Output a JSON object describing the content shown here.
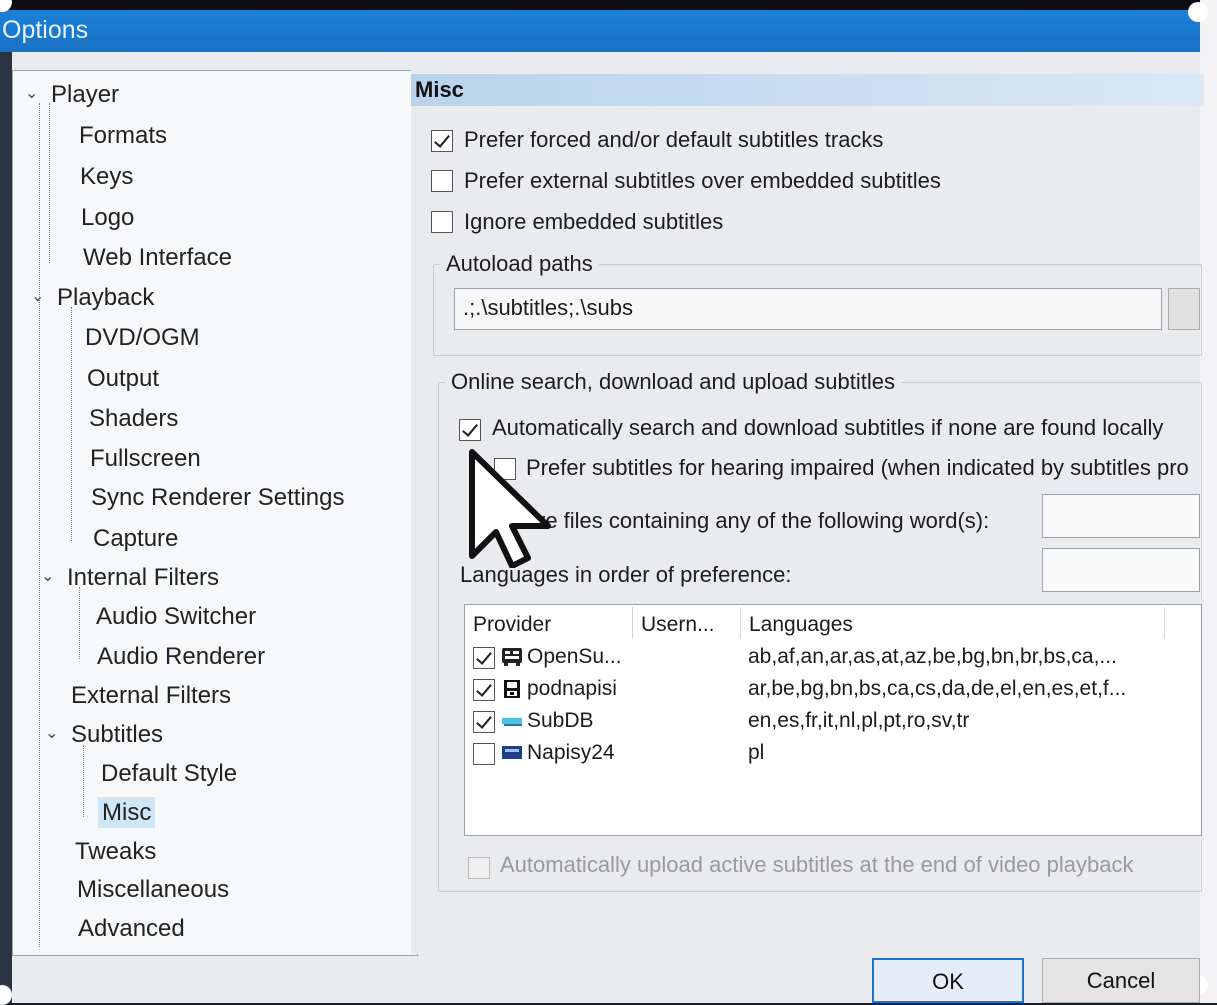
{
  "window": {
    "title": "Options"
  },
  "tree": {
    "items": [
      {
        "label": "Player",
        "expander": "⌄"
      },
      {
        "label": "Formats"
      },
      {
        "label": "Keys"
      },
      {
        "label": "Logo"
      },
      {
        "label": "Web Interface"
      },
      {
        "label": "Playback",
        "expander": "⌄"
      },
      {
        "label": "DVD/OGM"
      },
      {
        "label": "Output"
      },
      {
        "label": "Shaders"
      },
      {
        "label": "Fullscreen"
      },
      {
        "label": "Sync Renderer Settings"
      },
      {
        "label": "Capture"
      },
      {
        "label": "Internal Filters",
        "expander": "⌄"
      },
      {
        "label": "Audio Switcher"
      },
      {
        "label": "Audio Renderer"
      },
      {
        "label": "External Filters"
      },
      {
        "label": "Subtitles",
        "expander": "⌄"
      },
      {
        "label": "Default Style"
      },
      {
        "label": "Misc",
        "selected": true
      },
      {
        "label": "Tweaks"
      },
      {
        "label": "Miscellaneous"
      },
      {
        "label": "Advanced"
      }
    ]
  },
  "panel": {
    "header": "Misc",
    "options": {
      "prefer_forced": {
        "label": "Prefer forced and/or default subtitles tracks",
        "checked": true
      },
      "prefer_external": {
        "label": "Prefer external subtitles over embedded subtitles",
        "checked": false
      },
      "ignore_embedded": {
        "label": "Ignore embedded subtitles",
        "checked": false
      }
    },
    "autoload": {
      "title": "Autoload paths",
      "value": ".;.\\subtitles;.\\subs"
    },
    "online": {
      "title": "Online search, download and upload subtitles",
      "auto_search": {
        "label": "Automatically search and download subtitles if none are found locally",
        "checked": true
      },
      "hearing_impaired": {
        "label": "Prefer subtitles for hearing impaired (when indicated by subtitles pro",
        "checked": false
      },
      "exclude_label": "re files containing any of the following word(s):",
      "languages_label": "Languages in order of preference:",
      "upload": {
        "label": "Automatically upload active subtitles at the end of video playback",
        "checked": false
      }
    },
    "providers": {
      "columns": [
        "Provider",
        "Usern...",
        "Languages"
      ],
      "rows": [
        {
          "checked": true,
          "icon": "opensubtitles-icon",
          "name": "OpenSu...",
          "languages": "ab,af,an,ar,as,at,az,be,bg,bn,br,bs,ca,..."
        },
        {
          "checked": true,
          "icon": "podnapisi-icon",
          "name": "podnapisi",
          "languages": "ar,be,bg,bn,bs,ca,cs,da,de,el,en,es,et,f..."
        },
        {
          "checked": true,
          "icon": "subdb-icon",
          "name": "SubDB",
          "languages": "en,es,fr,it,nl,pl,pt,ro,sv,tr"
        },
        {
          "checked": false,
          "icon": "napisy24-icon",
          "name": "Napisy24",
          "languages": "pl"
        }
      ]
    }
  },
  "buttons": {
    "ok": "OK",
    "cancel": "Cancel"
  },
  "colors": {
    "titlebar": "#1d7fd6",
    "selection": "#cfe6f7",
    "ok_border": "#1a73c9"
  }
}
